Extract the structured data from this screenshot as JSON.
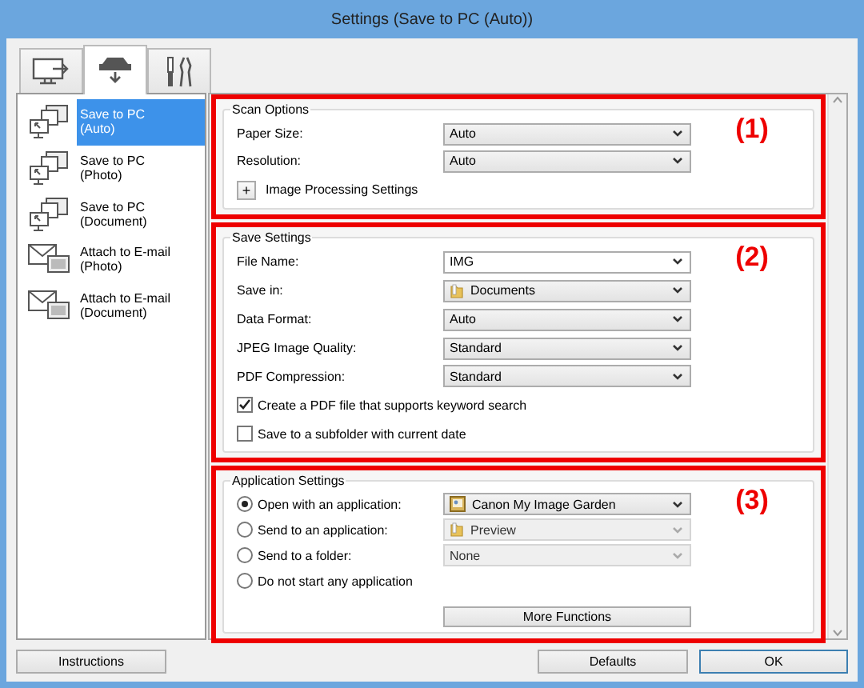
{
  "window": {
    "title": "Settings (Save to PC (Auto))"
  },
  "tabs": [
    {
      "kind": "monitor",
      "selected": false
    },
    {
      "kind": "scanner",
      "selected": true
    },
    {
      "kind": "tools",
      "selected": false
    }
  ],
  "sidebar": {
    "items": [
      {
        "kind": "save",
        "label": "Save to PC\n(Auto)",
        "selected": true
      },
      {
        "kind": "save",
        "label": "Save to PC\n(Photo)",
        "selected": false
      },
      {
        "kind": "save",
        "label": "Save to PC\n(Document)",
        "selected": false
      },
      {
        "kind": "mail",
        "label": "Attach to E-mail\n(Photo)",
        "selected": false
      },
      {
        "kind": "mail",
        "label": "Attach to E-mail\n(Document)",
        "selected": false
      }
    ]
  },
  "sections": [
    {
      "title": "Scan Options",
      "marker": "(1)",
      "rows": [
        {
          "kind": "select",
          "label": "Paper Size:",
          "value": "Auto",
          "disabled": false
        },
        {
          "kind": "select",
          "label": "Resolution:",
          "value": "Auto",
          "disabled": false
        },
        {
          "kind": "expander",
          "label": "Image Processing Settings",
          "symbol": "+"
        }
      ]
    },
    {
      "title": "Save Settings",
      "marker": "(2)",
      "rows": [
        {
          "kind": "editable",
          "label": "File Name:",
          "value": "IMG",
          "disabled": false
        },
        {
          "kind": "folder",
          "label": "Save in:",
          "value": "Documents",
          "disabled": false
        },
        {
          "kind": "select",
          "label": "Data Format:",
          "value": "Auto",
          "disabled": false
        },
        {
          "kind": "select",
          "label": "JPEG Image Quality:",
          "value": "Standard",
          "disabled": false
        },
        {
          "kind": "select",
          "label": "PDF Compression:",
          "value": "Standard",
          "disabled": false
        },
        {
          "kind": "checkbox",
          "label": "Create a PDF file that supports keyword search",
          "checked": true
        },
        {
          "kind": "checkbox",
          "label": "Save to a subfolder with current date",
          "checked": false
        }
      ]
    },
    {
      "title": "Application Settings",
      "marker": "(3)",
      "rows": [
        {
          "kind": "radio",
          "label": "Open with an application:",
          "selected": true,
          "select": {
            "kind": "app",
            "value": "Canon My Image Garden",
            "disabled": false
          }
        },
        {
          "kind": "radio",
          "label": "Send to an application:",
          "selected": false,
          "select": {
            "kind": "folder",
            "value": "Preview",
            "disabled": true
          }
        },
        {
          "kind": "radio",
          "label": "Send to a folder:",
          "selected": false,
          "select": {
            "kind": "select",
            "value": "None",
            "disabled": true
          }
        },
        {
          "kind": "radio",
          "label": "Do not start any application",
          "selected": false
        },
        {
          "kind": "button",
          "label": "More Functions"
        }
      ]
    }
  ],
  "buttons": {
    "instructions": "Instructions",
    "defaults": "Defaults",
    "ok": "OK"
  }
}
